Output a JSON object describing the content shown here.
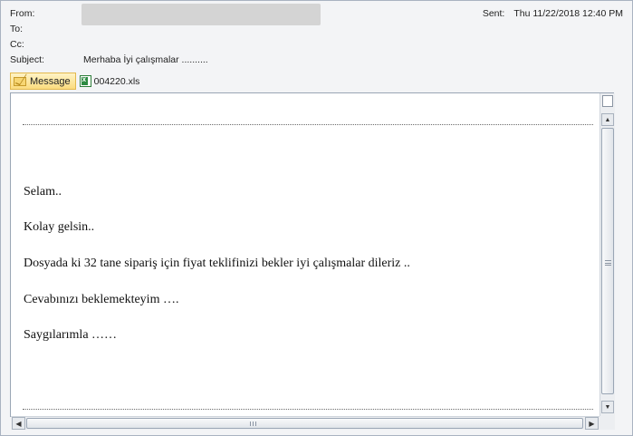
{
  "header": {
    "from_label": "From:",
    "to_label": "To:",
    "cc_label": "Cc:",
    "subject_label": "Subject:",
    "subject_value": "Merhaba İyi çalışmalar ..........",
    "sent_label": "Sent:",
    "sent_value": "Thu 11/22/2018 12:40 PM"
  },
  "attachments": {
    "message_tab_label": "Message",
    "file_name": "004220.xls",
    "message_icon": "envelope-icon",
    "file_icon": "excel-file-icon"
  },
  "body": {
    "lines": [
      "Selam..",
      "Kolay gelsin..",
      "Dosyada ki 32 tane sipariş için fiyat teklifinizi bekler iyi çalışmalar dileriz ..",
      "Cevabınızı beklemekteyim ….",
      "Saygılarımla ……"
    ]
  },
  "scrollbars": {
    "vertical_up": "▲",
    "vertical_down": "▼",
    "horizontal_left": "◀",
    "horizontal_right": "▶"
  }
}
